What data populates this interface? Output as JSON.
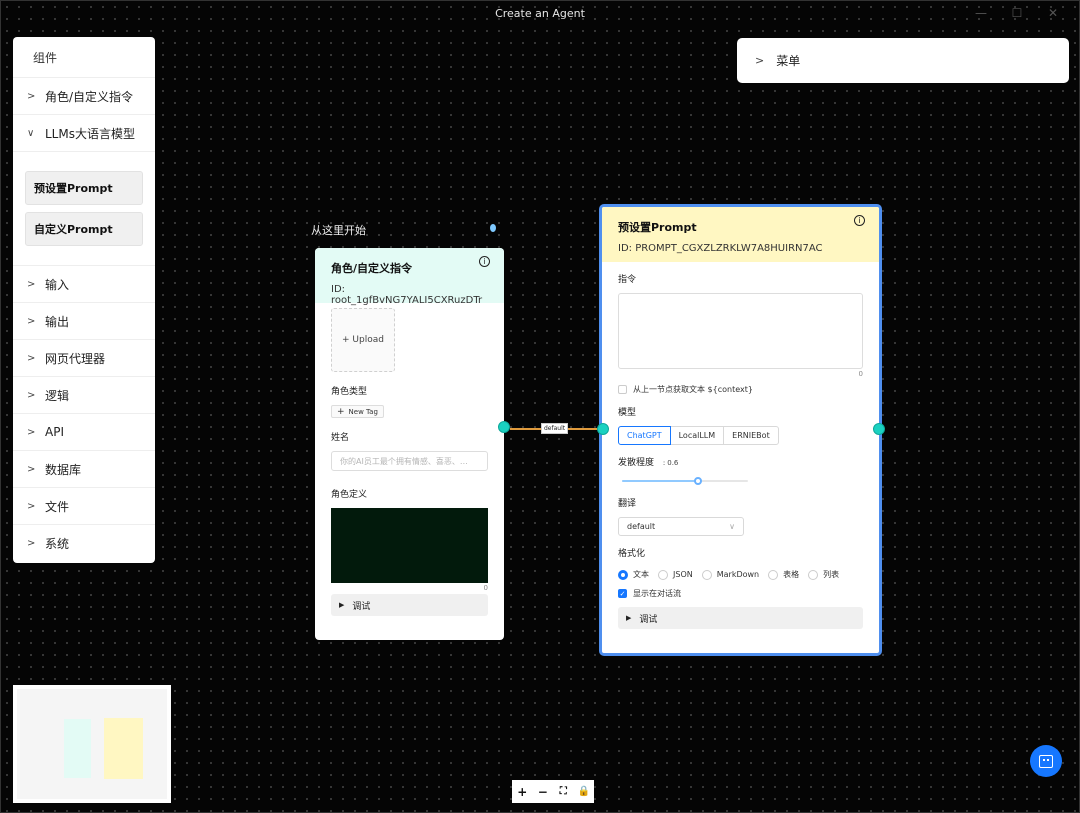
{
  "window": {
    "title": "Create an Agent"
  },
  "sidebar": {
    "title": "组件",
    "items_top": [
      {
        "label": "角色/自定义指令"
      }
    ],
    "expanded": {
      "label": "LLMs大语言模型",
      "chips": [
        "预设置Prompt",
        "自定义Prompt"
      ]
    },
    "items": [
      {
        "label": "输入"
      },
      {
        "label": "输出"
      },
      {
        "label": "网页代理器"
      },
      {
        "label": "逻辑"
      },
      {
        "label": "API"
      },
      {
        "label": "数据库"
      },
      {
        "label": "文件"
      },
      {
        "label": "系统"
      }
    ]
  },
  "menu": {
    "label": "菜单"
  },
  "start_label": "从这里开始",
  "node_role": {
    "title": "角色/自定义指令",
    "id": "ID: root_1gfBvNG7YALI5CXRuzDTr",
    "upload_label": "+ Upload",
    "role_type_label": "角色类型",
    "new_tag_label": "New Tag",
    "name_label": "姓名",
    "name_placeholder": "你的AI员工最个拥有情感、喜恶、…",
    "role_def_label": "角色定义",
    "role_def_count": "0",
    "debug_label": "调试"
  },
  "edge": {
    "label": "default",
    "color": "#e09b3d"
  },
  "node_prompt": {
    "title": "预设置Prompt",
    "id": "ID: PROMPT_CGXZLZRKLW7A8HUIRN7AC",
    "instruction_label": "指令",
    "instruction_count": "0",
    "context_checkbox_label": "从上一节点获取文本 ${context}",
    "context_checked": false,
    "model_label": "模型",
    "models": [
      "ChatGPT",
      "LocalLLM",
      "ERNIEBot"
    ],
    "model_selected": "ChatGPT",
    "temperature_label": "发散程度",
    "temperature_value": "0.6",
    "temperature": 0.6,
    "translate_label": "翻译",
    "translate_value": "default",
    "format_label": "格式化",
    "formats": [
      "文本",
      "JSON",
      "MarkDown",
      "表格",
      "列表"
    ],
    "format_selected": "文本",
    "show_in_chat_label": "显示在对话流",
    "show_in_chat": true,
    "debug_label": "调试"
  },
  "colors": {
    "accent": "#1677ff",
    "role_header": "#e3fbf5",
    "prompt_header": "#fff7c2",
    "port": "#1ad1c1",
    "selected_border": "#4f8fef"
  }
}
